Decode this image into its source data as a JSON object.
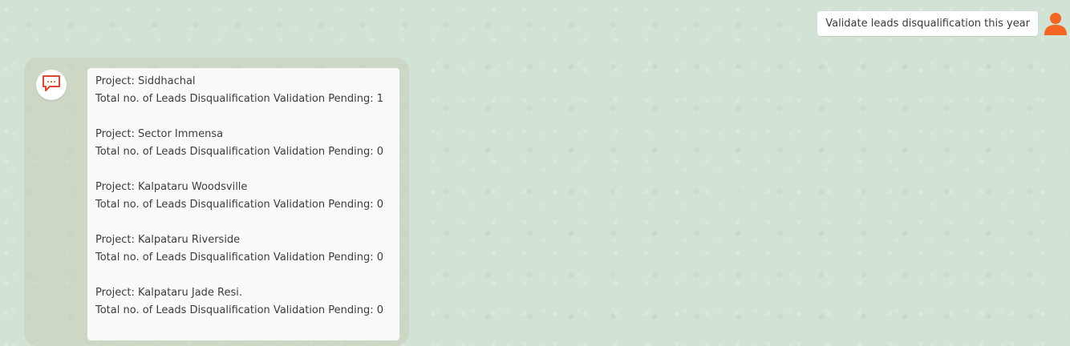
{
  "user_message": {
    "text": "Validate leads disqualification this year"
  },
  "bot_message": {
    "projects": [
      {
        "project_line": "Project: Siddhachal",
        "pending_line": "Total no. of Leads Disqualification Validation Pending: 1"
      },
      {
        "project_line": "Project: Sector Immensa",
        "pending_line": "Total no. of Leads Disqualification Validation Pending: 0"
      },
      {
        "project_line": "Project: Kalpataru Woodsville",
        "pending_line": "Total no. of Leads Disqualification Validation Pending: 0"
      },
      {
        "project_line": "Project: Kalpataru Riverside",
        "pending_line": "Total no. of Leads Disqualification Validation Pending: 0"
      },
      {
        "project_line": "Project: Kalpataru Jade Resi.",
        "pending_line": "Total no. of Leads Disqualification Validation Pending: 0"
      }
    ]
  },
  "colors": {
    "background": "#d2e3d6",
    "accent": "#f26522",
    "bubble": "#ffffff"
  },
  "icons": {
    "user": "user-avatar-icon",
    "bot": "chat-bubble-icon"
  }
}
